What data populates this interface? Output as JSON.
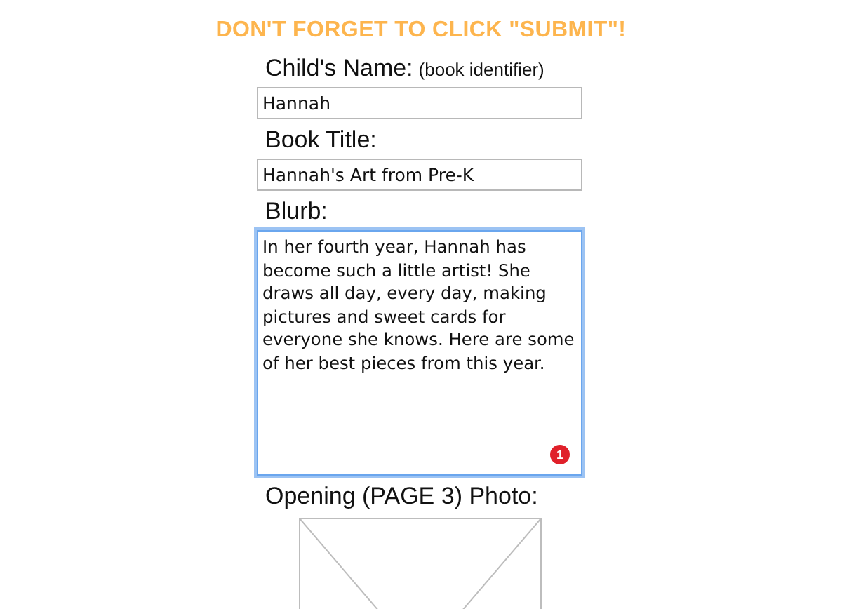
{
  "notice": "DON'T FORGET TO CLICK \"SUBMIT\"!",
  "fields": [
    {
      "kind": "input",
      "label": "Child's Name:",
      "hint": "(book identifier)",
      "value": "Hannah",
      "focused": false
    },
    {
      "kind": "input",
      "label": "Book Title:",
      "value": "Hannah's Art from Pre-K",
      "focused": false
    },
    {
      "kind": "textarea",
      "label": "Blurb:",
      "value": "In her fourth year, Hannah has become such a little artist! She draws all day, every day, making pictures and sweet cards for everyone she knows. Here are some of her best pieces from this year.",
      "badge": "1",
      "focused": true
    },
    {
      "kind": "photo",
      "label": "Opening (PAGE 3) Photo:"
    }
  ]
}
